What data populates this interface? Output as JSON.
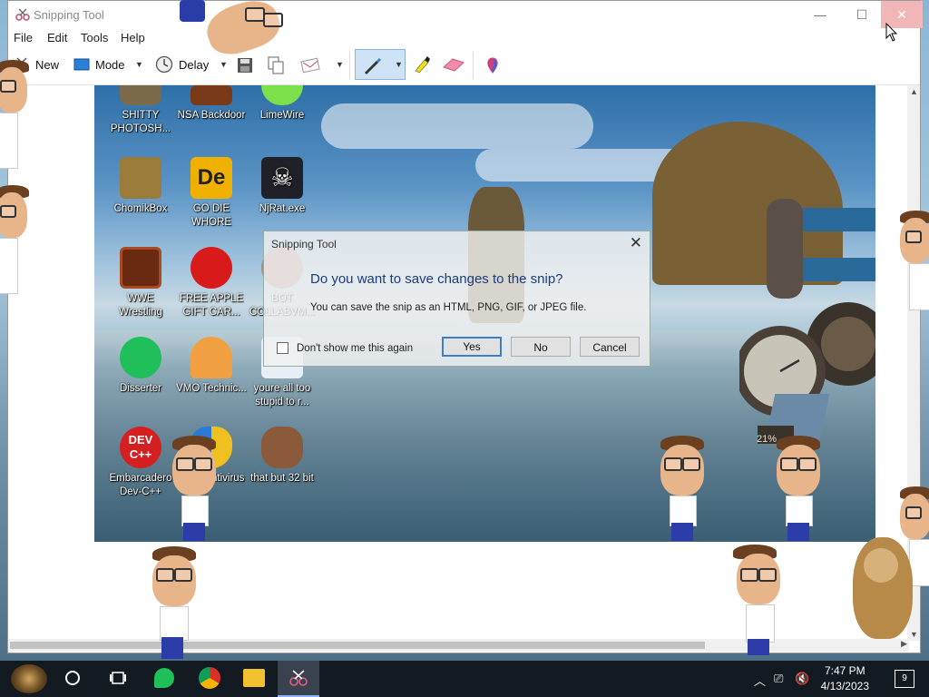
{
  "window": {
    "title": "Snipping Tool",
    "controls": {
      "minimize": "—",
      "maximize": "☐",
      "close": "✕"
    }
  },
  "menu": [
    "File",
    "Edit",
    "Tools",
    "Help"
  ],
  "toolbar": {
    "new_label": "New",
    "mode_label": "Mode",
    "delay_label": "Delay"
  },
  "desktop_icons": [
    {
      "label": "SHITTY PHOTOSH...",
      "icon": "gimp-icon"
    },
    {
      "label": "NSA Backdoor",
      "icon": "nsa-icon"
    },
    {
      "label": "LimeWire",
      "icon": "limewire-icon"
    },
    {
      "label": "ChomikBox",
      "icon": "chomikbox-icon"
    },
    {
      "label": "GO DIE WHORE",
      "icon": "de-icon"
    },
    {
      "label": "NjRat.exe",
      "icon": "skull-icon"
    },
    {
      "label": "WWE Wrestling",
      "icon": "wwe-icon"
    },
    {
      "label": "FREE APPLE GIFT CAR...",
      "icon": "apple-icon"
    },
    {
      "label": "BOT COLLABVM...",
      "icon": "bot-icon"
    },
    {
      "label": "Disserter",
      "icon": "disserter-icon"
    },
    {
      "label": "VMO Technic...",
      "icon": "vmo-icon"
    },
    {
      "label": "youre all too stupid to r...",
      "icon": "stupid-icon"
    },
    {
      "label": "Embarcadero Dev-C++",
      "icon": "devcpp-icon"
    },
    {
      "label": "VMO Antivirus",
      "icon": "antivirus-icon"
    },
    {
      "label": "that but 32 bit",
      "icon": "portrait-icon"
    }
  ],
  "dialog": {
    "title": "Snipping Tool",
    "close": "✕",
    "question": "Do you want to save changes to the snip?",
    "info": "You can save the snip as an HTML, PNG, GIF, or JPEG file.",
    "checkbox_label": "Don't show me this again",
    "yes_label": "Yes",
    "no_label": "No",
    "cancel_label": "Cancel"
  },
  "gauge_text": "21%",
  "taskbar": {
    "time": "7:47 PM",
    "date": "4/13/2023",
    "notification_count": "9"
  }
}
